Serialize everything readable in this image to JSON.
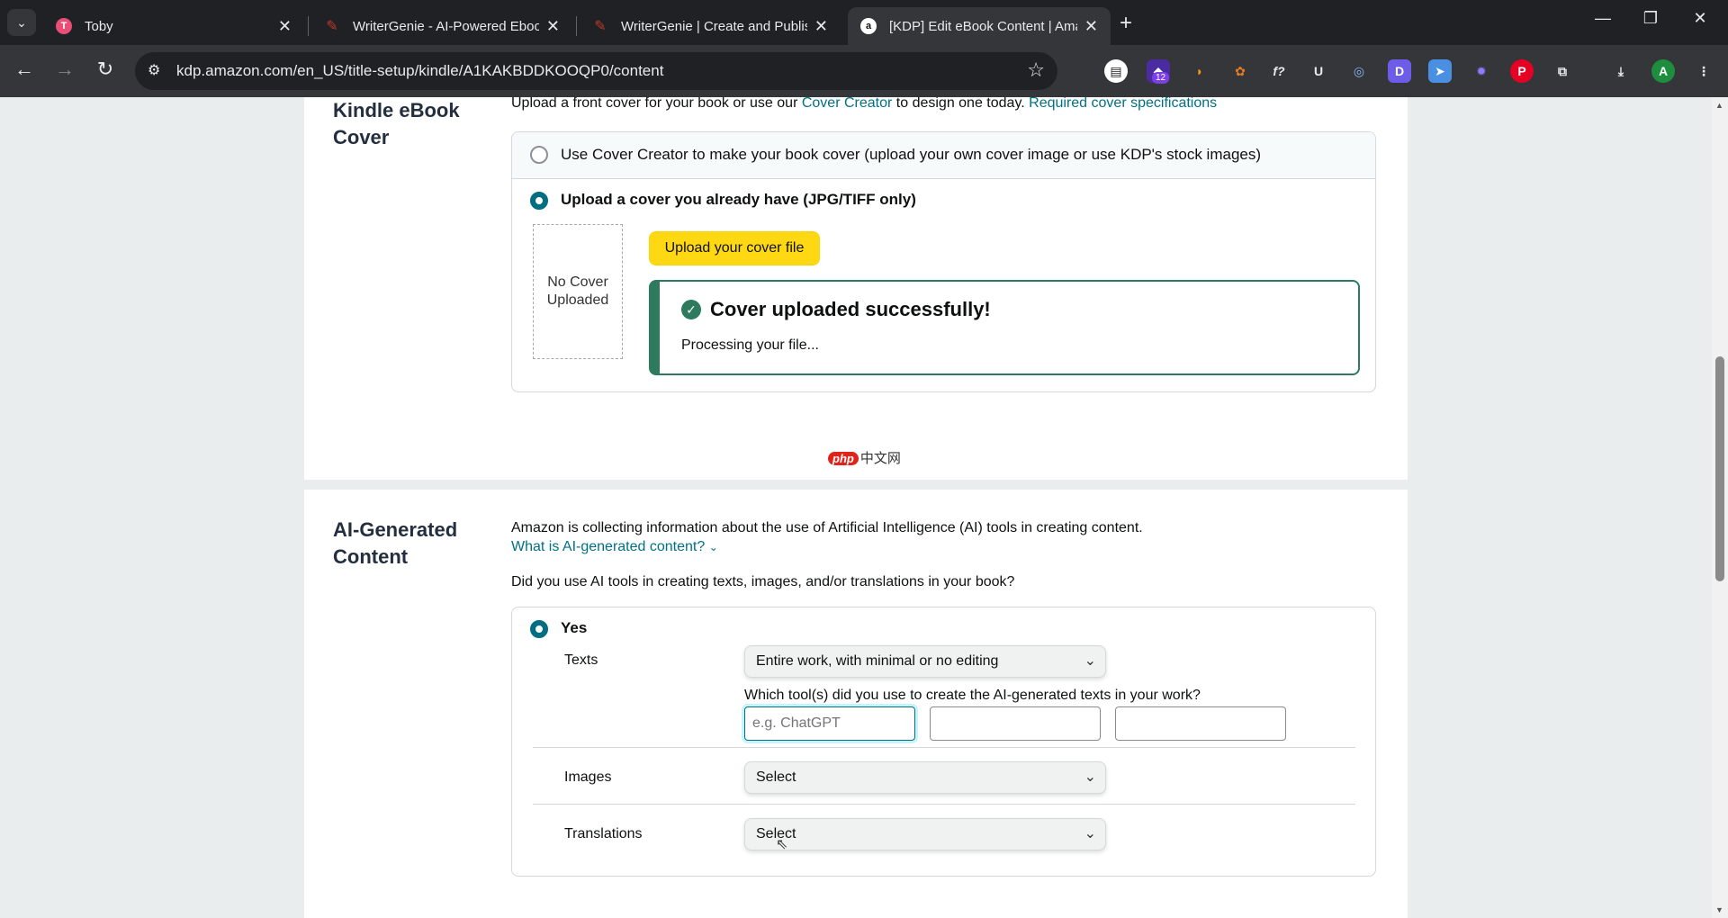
{
  "browser": {
    "tabs": [
      {
        "title": "Toby",
        "icon": "toby-icon",
        "color": "#e94e77"
      },
      {
        "title": "WriterGenie - AI-Powered Eboo",
        "icon": "feather-icon",
        "color": "#c0392b"
      },
      {
        "title": "WriterGenie | Create and Publis",
        "icon": "feather-icon",
        "color": "#c0392b"
      },
      {
        "title": "[KDP] Edit eBook Content | Ama",
        "icon": "amazon-icon",
        "color": "#ff9900"
      }
    ],
    "new_tab_glyph": "+",
    "url": "kdp.amazon.com/en_US/title-setup/kindle/A1KAKBDDKOOQP0/content",
    "extension_badge": "12"
  },
  "cover_section": {
    "title": "Kindle eBook Cover",
    "intro_prefix": "Upload a front cover for your book or use our ",
    "intro_link": "Cover Creator",
    "intro_suffix": " to design one today. ",
    "spec_link": "Required cover specifications",
    "option_creator": "Use Cover Creator to make your book cover (upload your own cover image or use KDP's stock images)",
    "option_upload": "Upload a cover you already have (JPG/TIFF only)",
    "no_cover_text": "No Cover Uploaded",
    "upload_button": "Upload your cover file",
    "success_heading": "Cover uploaded successfully!",
    "success_sub": "Processing your file..."
  },
  "watermark": {
    "brand": "php",
    "text": "中文网"
  },
  "ai_section": {
    "title": "AI-Generated Content",
    "intro": "Amazon is collecting information about the use of Artificial Intelligence (AI) tools in creating content.",
    "what_is_link": "What is AI-generated content?",
    "question": "Did you use AI tools in creating texts, images, and/or translations in your book?",
    "yes_label": "Yes",
    "texts_label": "Texts",
    "texts_value": "Entire work, with minimal or no editing",
    "tools_question": "Which tool(s) did you use to create the AI-generated texts in your work?",
    "tool_placeholder": "e.g. ChatGPT",
    "images_label": "Images",
    "images_value": "Select",
    "translations_label": "Translations",
    "translations_value": "Select"
  }
}
